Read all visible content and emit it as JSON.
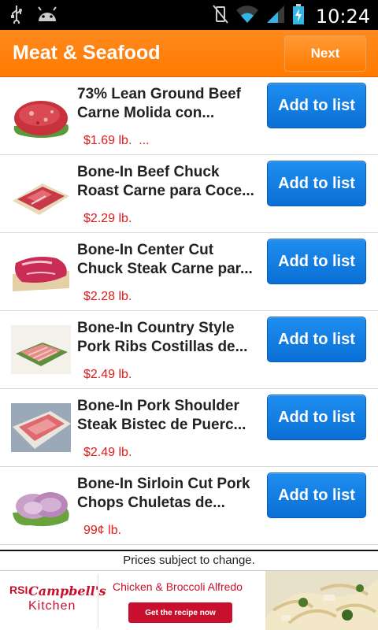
{
  "status_bar": {
    "time": "10:24",
    "icons": [
      "usb-icon",
      "android-icon",
      "mute-icon",
      "wifi-icon",
      "signal-icon",
      "battery-charging-icon"
    ]
  },
  "app_bar": {
    "title": "Meat & Seafood",
    "next_label": "Next",
    "accent_color": "#ff7a00"
  },
  "products": [
    {
      "name_line1": "73% Lean Ground Beef",
      "name_line2": "Carne Molida con...",
      "price": "$1.69 lb.  ...",
      "button": "Add to list",
      "image": "ground-beef-image"
    },
    {
      "name_line1": "Bone-In Beef Chuck",
      "name_line2": "Roast Carne para Coce...",
      "price": "$2.29 lb.",
      "button": "Add to list",
      "image": "chuck-roast-image"
    },
    {
      "name_line1": "Bone-In Center Cut",
      "name_line2": "Chuck Steak Carne par...",
      "price": "$2.28 lb.",
      "button": "Add to list",
      "image": "chuck-steak-image"
    },
    {
      "name_line1": "Bone-In Country Style",
      "name_line2": "Pork Ribs Costillas de...",
      "price": "$2.49 lb.",
      "button": "Add to list",
      "image": "pork-ribs-image"
    },
    {
      "name_line1": "Bone-In Pork Shoulder",
      "name_line2": "Steak Bistec de Puerc...",
      "price": "$2.49 lb.",
      "button": "Add to list",
      "image": "pork-shoulder-image"
    },
    {
      "name_line1": "Bone-In Sirloin Cut Pork",
      "name_line2": "Chops Chuletas de...",
      "price": "99¢ lb.",
      "button": "Add to list",
      "image": "pork-chops-image"
    }
  ],
  "footer_notice": "Prices subject to change.",
  "ad": {
    "brand": "Campbell's",
    "brand_sub": "Kitchen",
    "brand_mark": "RSI",
    "headline": "Chicken & Broccoli Alfredo",
    "cta": "Get the recipe now",
    "brand_color": "#c8102e"
  },
  "colors": {
    "button_blue": "#0a6fd6",
    "price_red": "#e21a1a"
  }
}
